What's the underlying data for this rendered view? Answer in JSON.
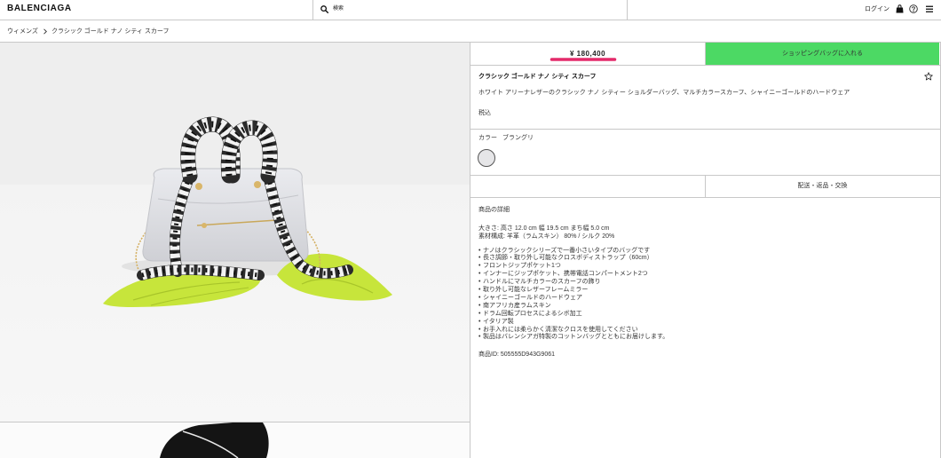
{
  "colors": {
    "accent_green": "#4cd964",
    "price_underline": "#e42a6a",
    "text": "#222222",
    "border": "#c8c8c8",
    "swatch_fill": "#e6e6e8"
  },
  "icons": {
    "search": "search-icon",
    "bag": "shopping-bag-icon",
    "help": "help-circle-icon",
    "menu": "hamburger-menu-icon",
    "breadcrumb_separator": "chevron-right-icon",
    "wishlist": "star-outline-icon"
  },
  "header": {
    "logo": "BALENCIAGA",
    "search_placeholder": "検索",
    "login_label": "ログイン"
  },
  "breadcrumb": {
    "items": [
      "ウィメンズ",
      "クラシック ゴールド ナノ シティ スカーフ"
    ]
  },
  "product": {
    "price": "¥ 180,400",
    "add_to_bag_label": "ショッピングバッグに入れる",
    "title": "クラシック ゴールド ナノ シティ スカーフ",
    "description": "ホワイト アリーナレザーのクラシック ナノ シティー ショルダーバッグ、マルチカラースカーフ、シャイニーゴールドのハードウェア",
    "tax_note": "税込",
    "color": {
      "label": "カラー",
      "value": "ブラングリ"
    },
    "shipping_label": "配送・返品・交換",
    "details": {
      "heading": "商品の詳細",
      "specs": [
        "大きさ: 高さ 12.0 cm 幅 19.5 cm まち幅 5.0 cm",
        "素材構成: 羊革（ラムスキン） 80% / シルク 20%"
      ],
      "bullets": [
        "ナノはクラシックシリーズで一番小さいタイプのバッグです",
        "長さ調節・取り外し可能なクロスボディストラップ（60cm）",
        "フロントジップポケット1つ",
        "インナーにジップポケット、携帯電話コンパートメント2つ",
        "ハンドルにマルチカラーのスカーフの飾り",
        "取り外し可能なレザーフレームミラー",
        "シャイニーゴールドのハードウェア",
        "南アフリカ産ラムスキン",
        "ドラム回転プロセスによるシボ加工",
        "イタリア製",
        "お手入れには柔らかく清潔なクロスを使用してください",
        "製品はバレンシアガ特製のコットンバッグとともにお届けします。"
      ],
      "product_id": "商品ID: 505555D943G9061"
    }
  }
}
